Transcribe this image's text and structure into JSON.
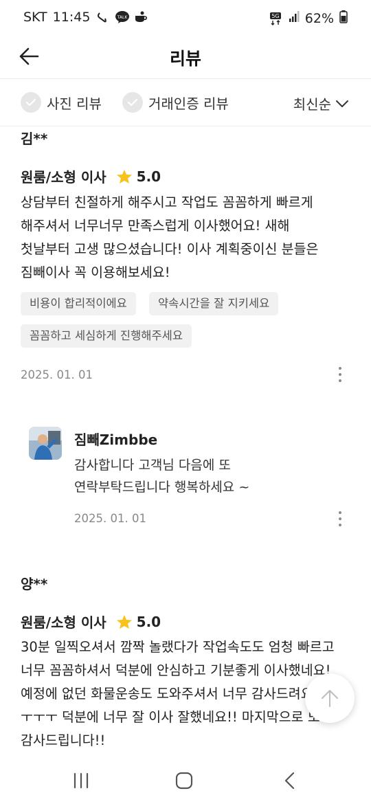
{
  "status_bar": {
    "carrier": "SKT",
    "time": "11:45",
    "network": "5G",
    "battery": "62%"
  },
  "header": {
    "title": "리뷰"
  },
  "filters": {
    "photo_review": "사진 리뷰",
    "verified_review": "거래인증 리뷰",
    "sort": "최신순"
  },
  "reviews": [
    {
      "reviewer": "김**",
      "service": "원룸/소형 이사",
      "rating": "5.0",
      "lines": [
        "상담부터 친절하게 해주시고 작업도 꼼꼼하게 빠르게",
        "해주셔서 너무너무 만족스럽게 이사했어요! 새해",
        "첫날부터 고생 많으셨습니다! 이사 계획중이신 분들은",
        "짐빼이사 꼭 이용해보세요!"
      ],
      "tags": [
        "비용이 합리적이에요",
        "약속시간을 잘 지키세요",
        "꼼꼼하고 세심하게 진행해주세요"
      ],
      "date": "2025. 01. 01",
      "reply": {
        "name": "짐빼Zimbbe",
        "lines": [
          "감사합니다 고객님 다음에 또",
          "연락부탁드립니다 행복하세요 ~"
        ],
        "date": "2025. 01. 01"
      }
    },
    {
      "reviewer": "양**",
      "service": "원룸/소형 이사",
      "rating": "5.0",
      "lines": [
        "30분 일찍오셔서 깜짝 놀랬다가 작업속도도 엄청 빠르고",
        "너무 꼼꼼하셔서 덕분에 안심하고 기분좋게 이사했네요!",
        "예정에 없던 화물운송도 도와주셔서 너무 감사드려요",
        "ㅜㅜㅜ 덕분에 너무 잘 이사 잘했네요!! 마지막으로 또",
        "감사드립니다!!"
      ]
    }
  ],
  "colors": {
    "star": "#F5C31B",
    "divider": "#ECECEC",
    "tag_bg": "#F1F1F1"
  }
}
